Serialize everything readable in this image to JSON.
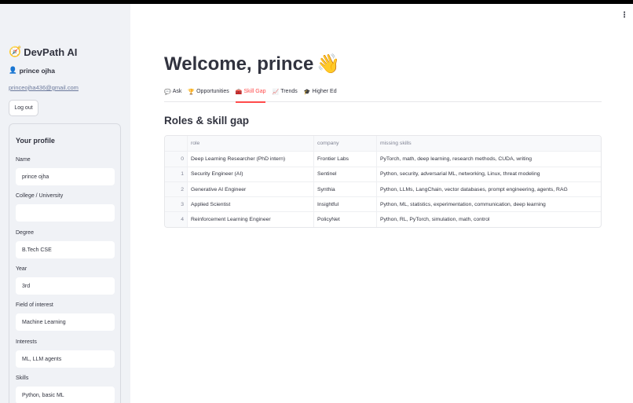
{
  "sidebar": {
    "brand_icon": "compass-icon",
    "brand": "DevPath AI",
    "user_icon": "user-icon",
    "user_name": "prince ojha",
    "email": "princeojha436@gmail.com",
    "logout_label": "Log out",
    "profile": {
      "title": "Your profile",
      "fields": [
        {
          "label": "Name",
          "value": "prince ojha"
        },
        {
          "label": "College / University",
          "value": ""
        },
        {
          "label": "Degree",
          "value": "B.Tech CSE"
        },
        {
          "label": "Year",
          "value": "3rd"
        },
        {
          "label": "Field of interest",
          "value": "Machine Learning"
        },
        {
          "label": "Interests",
          "value": "ML, LLM agents"
        },
        {
          "label": "Skills",
          "value": "Python, basic ML"
        }
      ]
    }
  },
  "header": {
    "menu_icon": "kebab-menu-icon",
    "menu_glyph": "⋮"
  },
  "main": {
    "welcome": "Welcome, prince",
    "welcome_emoji": "👋",
    "tabs": [
      {
        "icon": "💬",
        "label": "Ask"
      },
      {
        "icon": "🏆",
        "label": "Opportunities"
      },
      {
        "icon": "🧰",
        "label": "Skill Gap",
        "active": true
      },
      {
        "icon": "📈",
        "label": "Trends"
      },
      {
        "icon": "🎓",
        "label": "Higher Ed"
      }
    ],
    "section_title": "Roles & skill gap",
    "table": {
      "columns": [
        "",
        "role",
        "company",
        "missing skills"
      ],
      "rows": [
        {
          "index": "0",
          "role": "Deep Learning Researcher (PhD intern)",
          "company": "Frontier Labs",
          "skills": "PyTorch, math, deep learning, research methods, CUDA, writing"
        },
        {
          "index": "1",
          "role": "Security Engineer (AI)",
          "company": "Sentinel",
          "skills": "Python, security, adversarial ML, networking, Linux, threat modeling"
        },
        {
          "index": "2",
          "role": "Generative AI Engineer",
          "company": "Synthia",
          "skills": "Python, LLMs, LangChain, vector databases, prompt engineering, agents, RAG"
        },
        {
          "index": "3",
          "role": "Applied Scientist",
          "company": "Insightful",
          "skills": "Python, ML, statistics, experimentation, communication, deep learning"
        },
        {
          "index": "4",
          "role": "Reinforcement Learning Engineer",
          "company": "PolicyNet",
          "skills": "Python, RL, PyTorch, simulation, math, control"
        }
      ]
    }
  }
}
